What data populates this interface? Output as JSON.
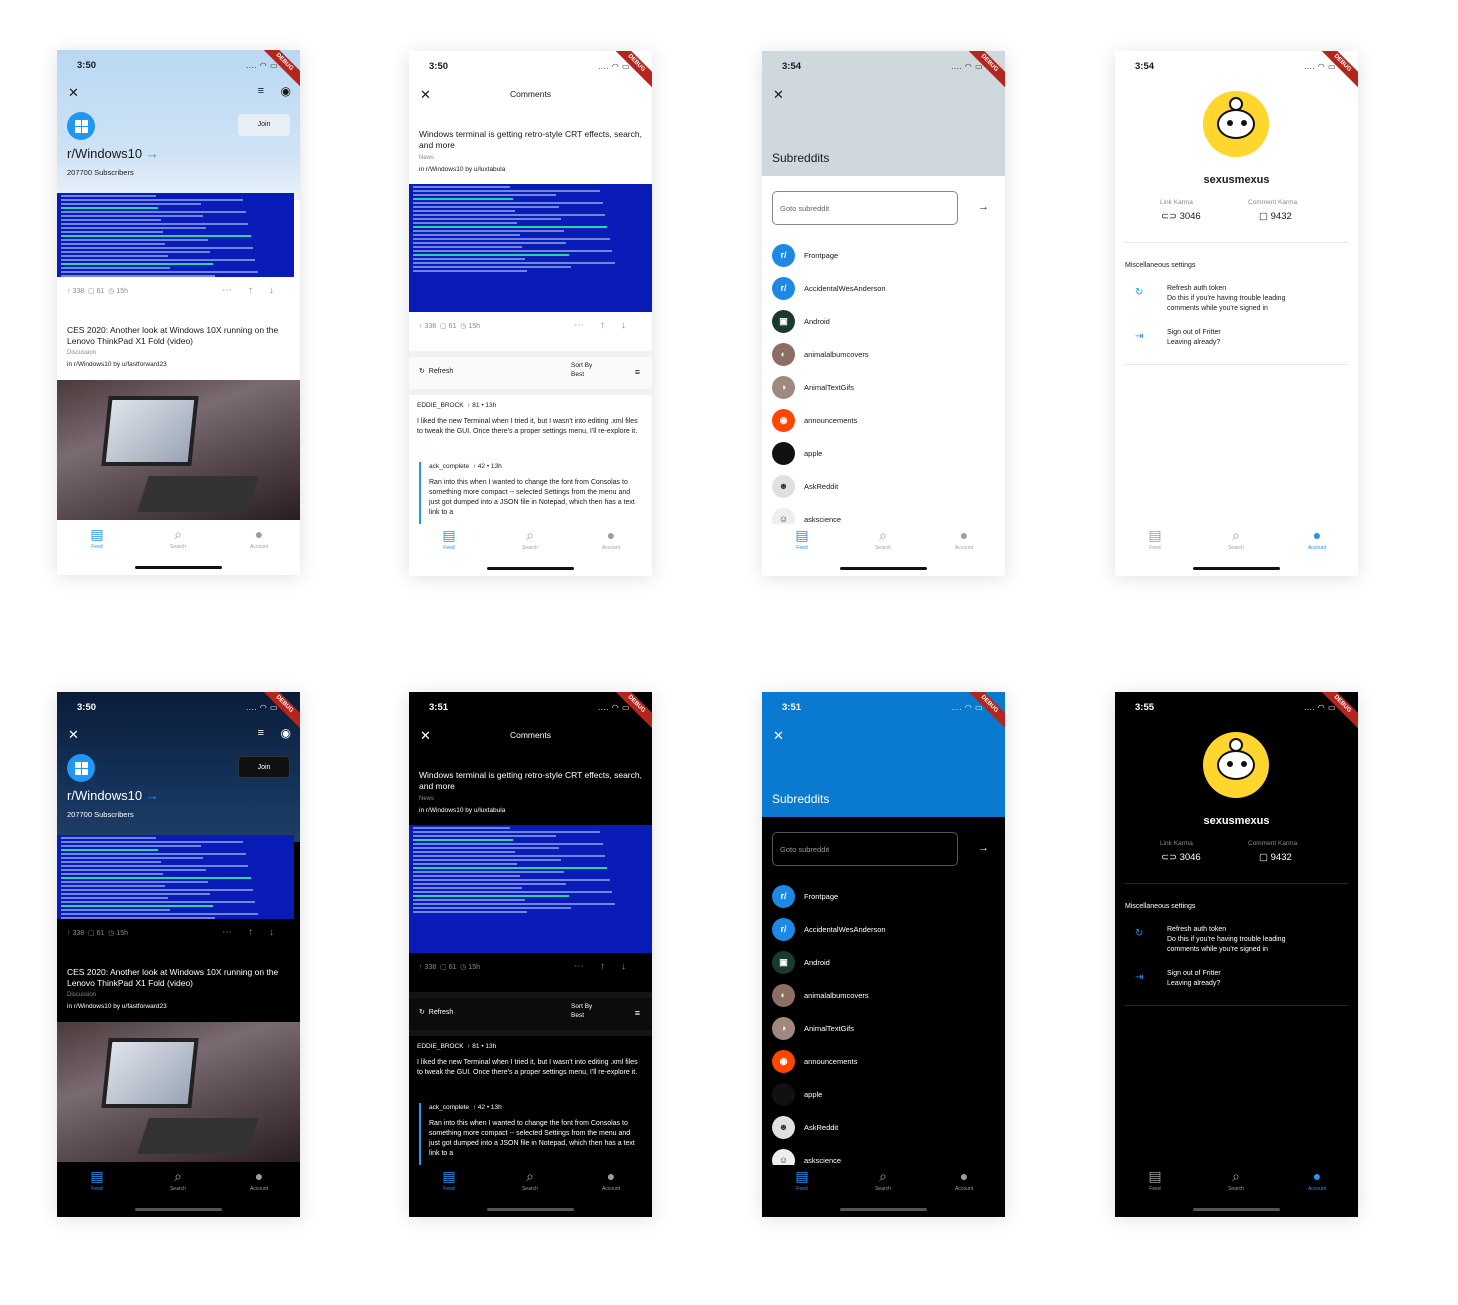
{
  "common": {
    "debug_label": "DEBUG",
    "signal": "....",
    "close_glyph": "✕",
    "nav": {
      "feed": "Feed",
      "search": "Search",
      "account": "Account"
    }
  },
  "times": [
    "3:50",
    "3:50",
    "3:54",
    "3:54",
    "3:50",
    "3:51",
    "3:51",
    "3:55"
  ],
  "feed": {
    "subreddit": "r/Windows10",
    "subscribers": "207700 Subscribers",
    "join": "Join",
    "post1": {
      "upvotes": "338",
      "comments": "61",
      "age": "15h"
    },
    "post2": {
      "title": "CES 2020: Another look at Windows 10X running on the Lenovo ThinkPad X1 Fold (video)",
      "flair": "Discussion",
      "byline": "in r/Windows10 by u/fastforward23"
    }
  },
  "comments_page": {
    "title": "Comments",
    "post_title": "Windows terminal is getting retro-style CRT effects, search, and more",
    "flair": "News",
    "byline": "in r/Windows10 by u/luxtabula",
    "upvotes": "338",
    "comments": "61",
    "age": "15h",
    "refresh": "Refresh",
    "sort_by": "Sort By",
    "sort_value": "Best",
    "comment1": {
      "author": "EDDIE_BROCK",
      "meta": "81 • 13h",
      "text": "I liked the new Terminal when I tried it, but I wasn't into editing .xml files to tweak the GUI. Once there's a proper settings menu, I'll re-explore it."
    },
    "comment2": {
      "author": "ack_complete",
      "meta": "42 • 13h",
      "text": "Ran into this when I wanted to change the font from Consolas to something more compact -- selected Settings from the menu and just got dumped into a JSON file in Notepad, which then has a text link to a"
    }
  },
  "subreddits_page": {
    "title": "Subreddits",
    "goto_placeholder": "Goto subreddit",
    "items": [
      "Frontpage",
      "AccidentalWesAnderson",
      "Android",
      "animalalbumcovers",
      "AnimalTextGifs",
      "announcements",
      "apple",
      "AskReddit",
      "askscience"
    ]
  },
  "account_page": {
    "username": "sexusmexus",
    "link_karma_label": "Link Karma",
    "link_karma": "3046",
    "comment_karma_label": "Comment Karma",
    "comment_karma": "9432",
    "misc_title": "Miscellaneous settings",
    "refresh_title": "Refresh auth token",
    "refresh_desc": "Do this if you're having trouble leading comments while you're signed in",
    "signout_title": "Sign out of Fritter",
    "signout_desc": "Leaving already?"
  },
  "colors": {
    "accent": "#2196f3",
    "terminal_blue": "#0a1cb8",
    "debug_red": "#b3261e",
    "subreddits_header_light": "#cfd8dc",
    "subreddits_header_dark": "#0a7ad0"
  }
}
